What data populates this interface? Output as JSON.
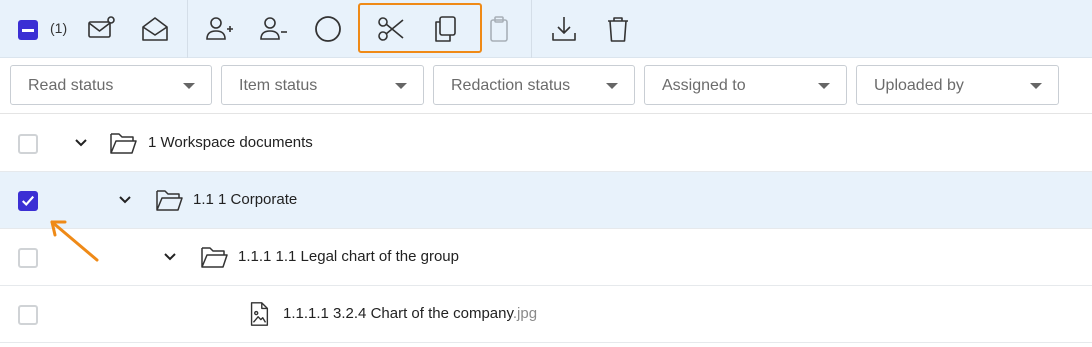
{
  "toolbar": {
    "selected_count": "(1)",
    "buttons": [
      {
        "name": "unread-mail-icon"
      },
      {
        "name": "open-mail-icon"
      },
      {
        "name": "add-user-icon"
      },
      {
        "name": "remove-user-icon"
      },
      {
        "name": "circle-icon"
      },
      {
        "name": "scissors-icon"
      },
      {
        "name": "copy-icon"
      },
      {
        "name": "clipboard-icon"
      },
      {
        "name": "download-icon"
      },
      {
        "name": "trash-icon"
      }
    ],
    "accent": "#3b2fd4",
    "highlight_color": "#ef8a17"
  },
  "filters": [
    {
      "label": "Read status"
    },
    {
      "label": "Item status"
    },
    {
      "label": "Redaction status"
    },
    {
      "label": "Assigned to"
    },
    {
      "label": "Uploaded by"
    }
  ],
  "rows": [
    {
      "text": "1 Workspace documents",
      "ext": "",
      "icon": "folder-open-icon",
      "expanded": true,
      "checked": false
    },
    {
      "text": "1.1  1 Corporate",
      "ext": "",
      "icon": "folder-open-icon",
      "expanded": true,
      "checked": true
    },
    {
      "text": "1.1.1  1.1 Legal chart of the group",
      "ext": "",
      "icon": "folder-open-icon",
      "expanded": true,
      "checked": false
    },
    {
      "text": "1.1.1.1  3.2.4 Chart of the company",
      "ext": ".jpg",
      "icon": "image-file-icon",
      "expanded": false,
      "checked": false
    }
  ]
}
